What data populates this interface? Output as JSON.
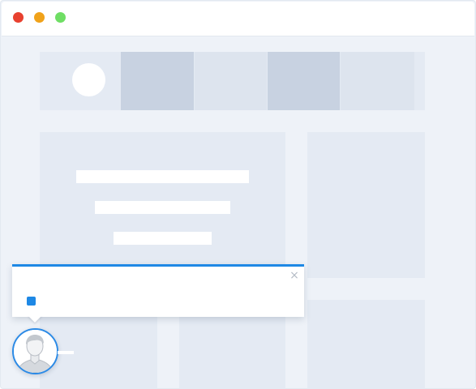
{
  "window": {
    "controls": [
      {
        "name": "close",
        "color": "#e8412f"
      },
      {
        "name": "minimize",
        "color": "#f0a21a"
      },
      {
        "name": "maximize",
        "color": "#6fde64"
      }
    ]
  },
  "popup": {
    "close_glyph": "×",
    "accent_color": "#1e88e5"
  },
  "avatar": {
    "icon": "user-silhouette-icon"
  }
}
